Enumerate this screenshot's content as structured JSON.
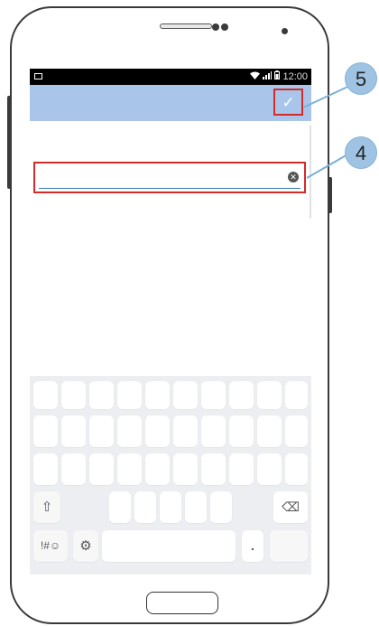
{
  "status_bar": {
    "time": "12:00",
    "icons": [
      "image-icon",
      "wifi-icon",
      "signal-icon",
      "battery-icon"
    ]
  },
  "app_bar": {
    "confirm_icon": "✓"
  },
  "input": {
    "value": "",
    "clear_icon": "✕"
  },
  "keyboard": {
    "shift_icon": "⇧",
    "backspace_icon": "⌫",
    "symbols_label": "!#☺",
    "settings_icon": "⚙",
    "period_label": "."
  },
  "callouts": [
    {
      "number": "5"
    },
    {
      "number": "4"
    }
  ],
  "colors": {
    "app_bar": "#a9c6ea",
    "highlight": "#d42a2a",
    "badge": "#9fc4e3",
    "input_underline": "#3b79c0"
  }
}
